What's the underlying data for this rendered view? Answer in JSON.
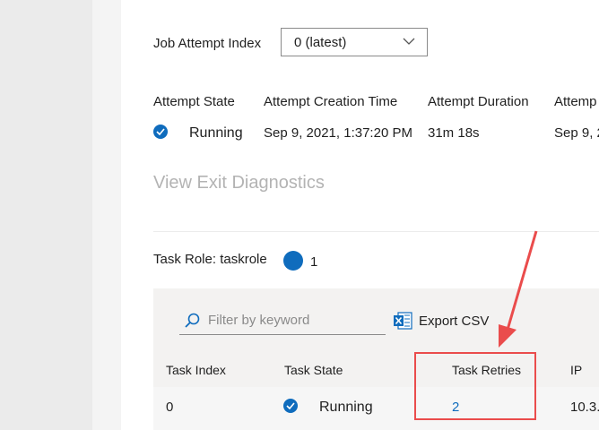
{
  "attempt": {
    "label": "Job Attempt Index",
    "selected": "0 (latest)"
  },
  "summary": {
    "headers": [
      "Attempt State",
      "Attempt Creation Time",
      "Attempt Duration",
      "Attemp"
    ],
    "values": {
      "state": "Running",
      "creation_time": "Sep 9, 2021, 1:37:20 PM",
      "duration": "31m 18s",
      "partial": "Sep 9, 2"
    }
  },
  "diagnostics_link": "View Exit Diagnostics",
  "task_role": {
    "label": "Task Role: taskrole",
    "count": "1"
  },
  "toolbar": {
    "filter_placeholder": "Filter by keyword",
    "export_label": "Export CSV"
  },
  "table": {
    "columns": [
      "Task Index",
      "Task State",
      "Task Retries",
      "IP"
    ],
    "rows": [
      {
        "index": "0",
        "state": "Running",
        "retries": "2",
        "ip": "10.3."
      }
    ]
  },
  "colors": {
    "accent": "#0f6cbd",
    "highlight": "#ea4c4c"
  }
}
